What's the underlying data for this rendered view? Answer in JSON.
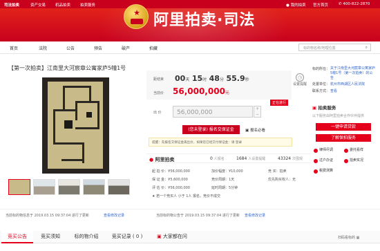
{
  "topbar": {
    "logo": "司法拍卖",
    "nav": [
      "资产交易",
      "机品拍卖",
      "拍卖服务"
    ],
    "my_auction": "我的拍卖",
    "home": "官方首页",
    "hotline": "400-822-2870"
  },
  "banner": {
    "title": "阿里拍卖·司法"
  },
  "nav": {
    "items": [
      "首页",
      "法院",
      "公告",
      "预告",
      "破产",
      "拍藏"
    ],
    "search_placeholder": "标的物名称/地理位置"
  },
  "lot": {
    "title": "【第一次拍卖】江南里大河宸章公寓家庐5幢1号",
    "countdown_label": "距结束",
    "countdown": {
      "days": "00",
      "days_unit": "天",
      "hours": "15",
      "hours_unit": "时",
      "minutes": "48",
      "minutes_unit": "分",
      "seconds": "55.9",
      "seconds_unit": "秒"
    },
    "current_price_label": "当前价",
    "current_price": "56,000,000",
    "price_unit": "元",
    "remind_label": "设置提醒",
    "status_tag": "正在进行",
    "bid_label": "出  价",
    "bid_value": "56,000,000",
    "stepper_plus": "+",
    "stepper_minus": "−",
    "signup_button": "(您未登录) 报名交保证金",
    "must_know": "报名必看",
    "tip": "提醒：先报名交保证金再出价，如果您已经交付保证金：请 登录"
  },
  "stats": {
    "platform_logo": "阿里拍卖",
    "signups": "0",
    "signups_label": "人报名",
    "reminders": "1684",
    "reminders_label": "人设置提醒",
    "views": "43324",
    "views_label": "次围观"
  },
  "info": {
    "start_price": "起 拍 价：¥56,000,000",
    "increment": "加价幅度：¥10,000",
    "method": "竞    买：拍卖",
    "deposit": "保 证 金：¥5,600,000",
    "cycle": "竞价周期：1天",
    "priority": "优先购买权人：无",
    "evaluation": "评 估 价：¥56,000,000",
    "delay": "延时周期：5分钟",
    "note": "★ 若一个竞买人 小于 1人 报名，竞价不成交"
  },
  "side": {
    "court_label": "标的所在：",
    "court_notice": "关于江南里大河宸章公寓家庐5幢1号（第一次拍卖）的公告",
    "handler_label": "处置单位：",
    "handler": "杭州市西湖区人民法院",
    "contact_label": "联系方式：",
    "contact": "查看",
    "service_title": "拍卖服务",
    "service_desc": "以下服务由阿里拍卖合作伙伴提供",
    "btn_loan": "一键申请贷款",
    "btn_service": "了解保拍服务",
    "services": [
      "律师尽调",
      "委托看样",
      "过户办证",
      "拍卖实况",
      "税费测算"
    ]
  },
  "notices": [
    {
      "label": "当前标的物信息于 2019.03.15 09:37:04 进行了更新",
      "link": "查看修改记录"
    },
    {
      "label": "当前标的物公告于 2019.03.15 09:37:04 进行了更新",
      "link": "查看修改记录"
    }
  ],
  "tabs": {
    "items": [
      "竞买公告",
      "竞买须知",
      "标的物介绍",
      "竞买记录 ( 0 )",
      "大家都在问"
    ],
    "scan": "扫码看标的"
  },
  "colors": {
    "brand_red": "#c8001e",
    "price_red": "#e4001b",
    "link_blue": "#3366cc"
  }
}
